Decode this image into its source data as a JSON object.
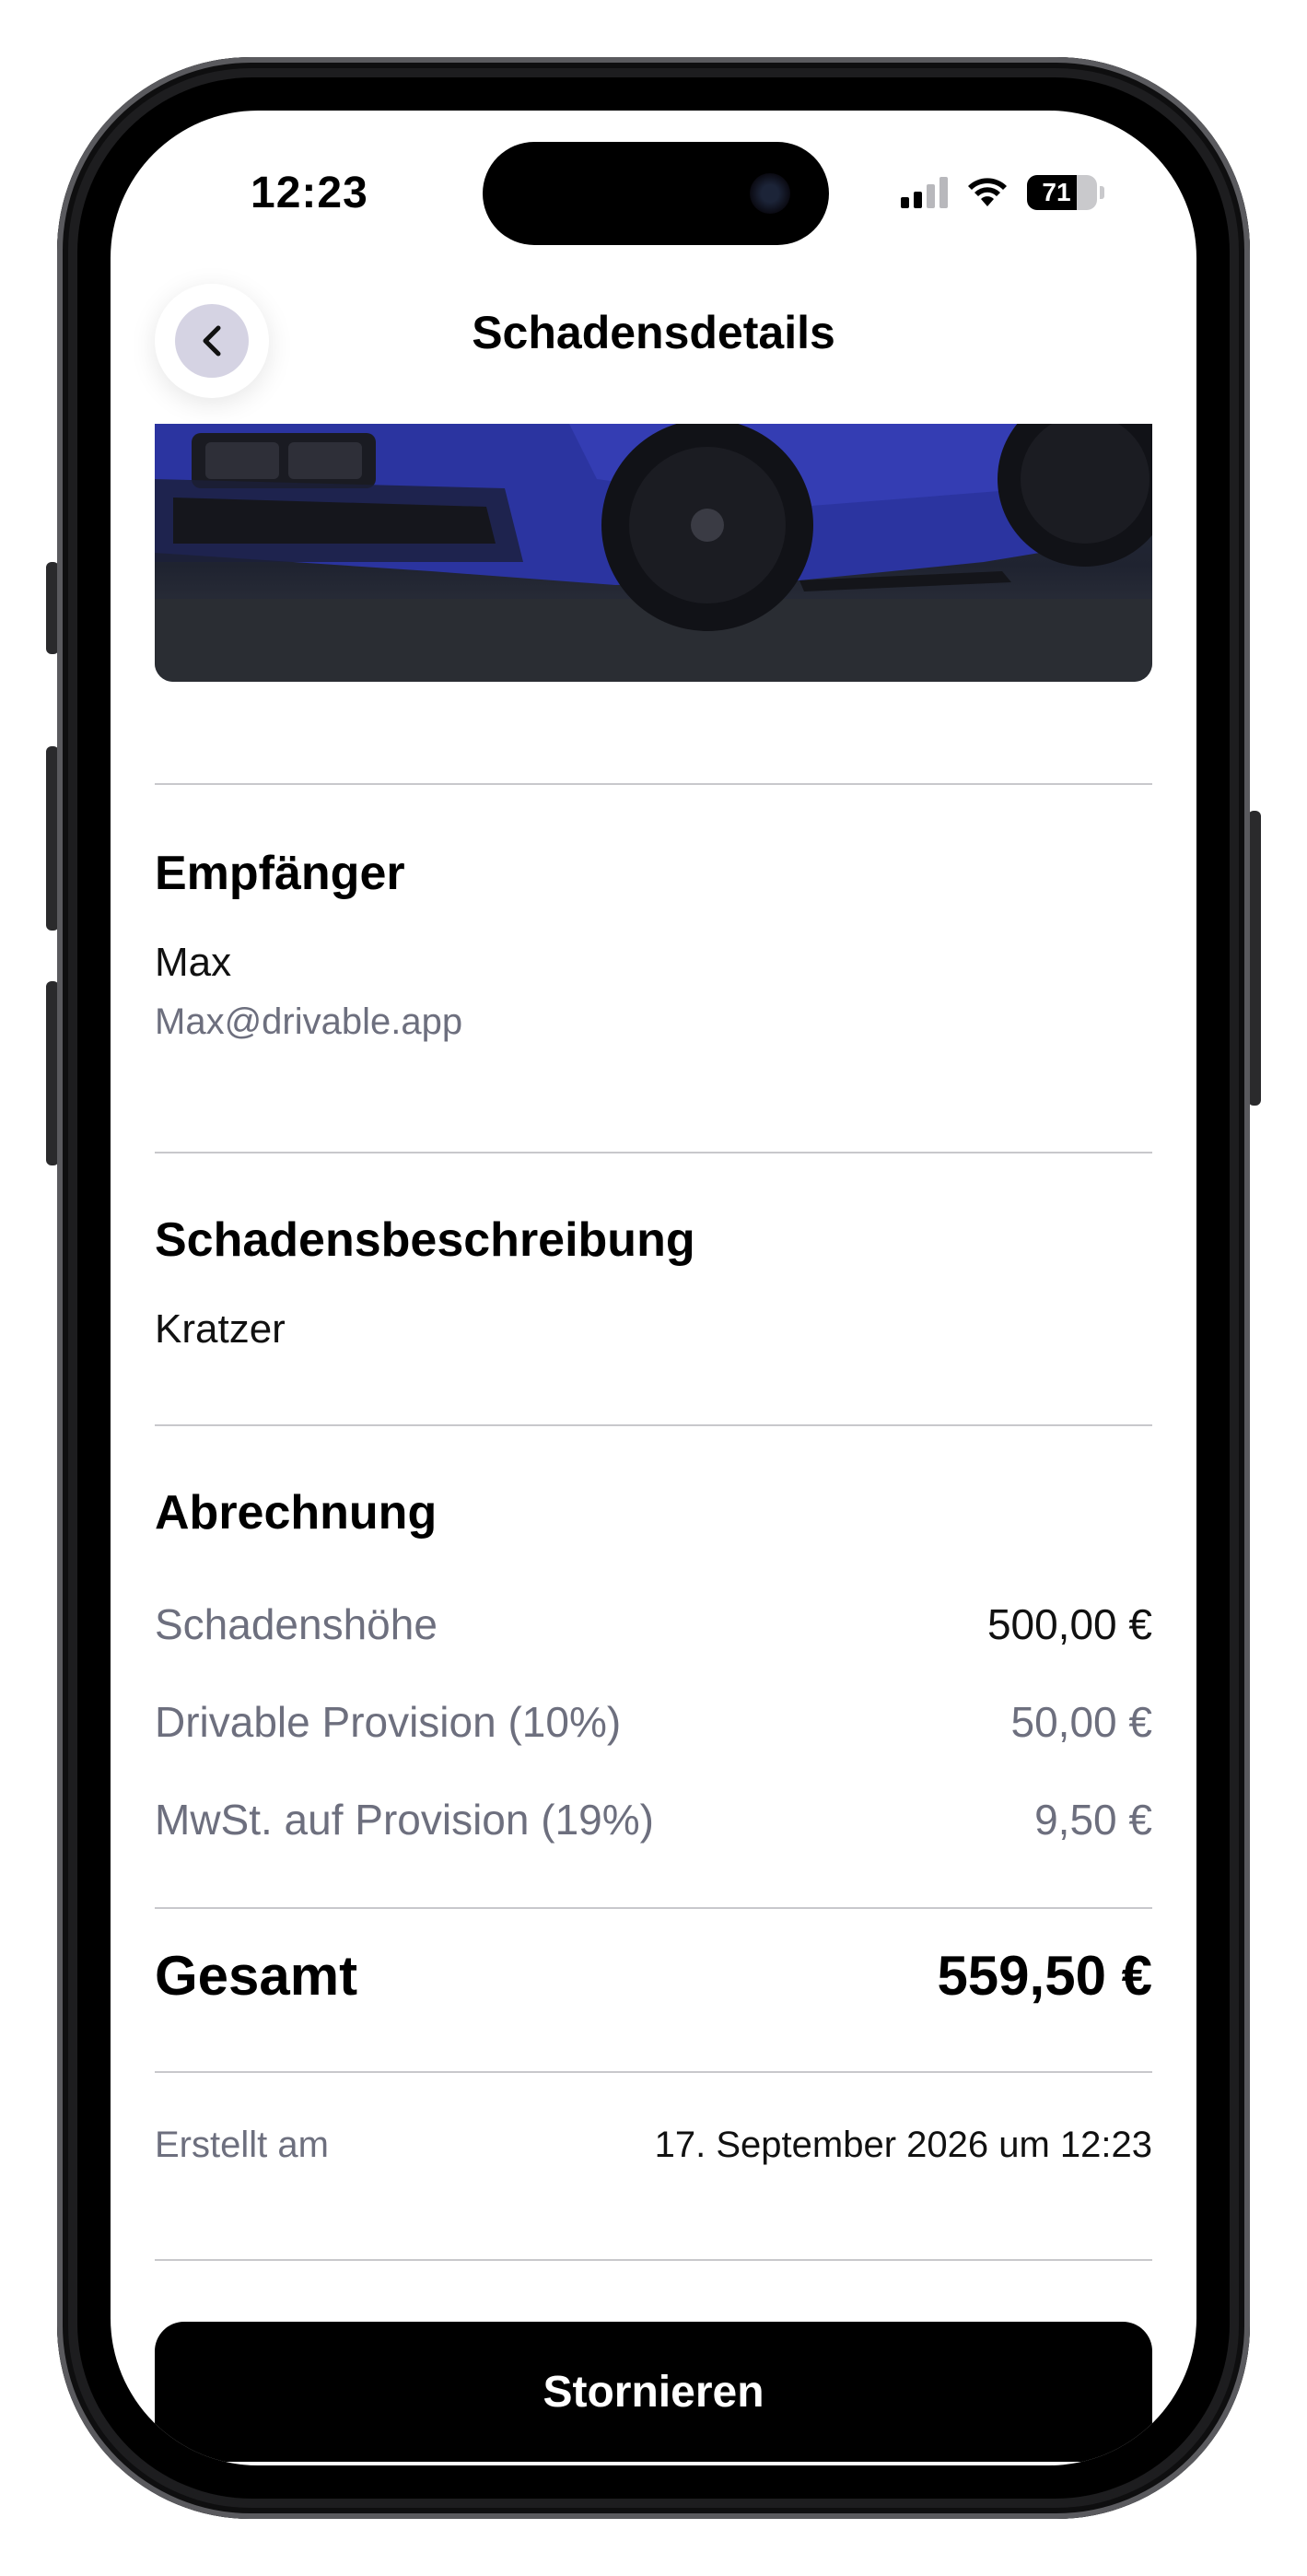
{
  "status_bar": {
    "time": "12:23",
    "battery_level": "71",
    "battery_fraction": 0.71,
    "signal_bars_active": 2,
    "signal_bars_total": 4
  },
  "header": {
    "title": "Schadensdetails",
    "back_icon": "chevron-left-icon"
  },
  "recipient": {
    "heading": "Empfänger",
    "name": "Max",
    "email": "Max@drivable.app"
  },
  "description": {
    "heading": "Schadensbeschreibung",
    "text": "Kratzer"
  },
  "billing": {
    "heading": "Abrechnung",
    "rows": [
      {
        "label": "Schadenshöhe",
        "value": "500,00 €"
      },
      {
        "label": "Drivable Provision (10%)",
        "value": "50,00 €"
      },
      {
        "label": "MwSt. auf Provision (19%)",
        "value": "9,50 €"
      }
    ],
    "total_label": "Gesamt",
    "total_value": "559,50 €"
  },
  "meta": {
    "created_label": "Erstellt am",
    "created_value": "17. September 2026 um 12:23"
  },
  "actions": {
    "cancel_label": "Stornieren"
  },
  "colors": {
    "primary_button": "#000000",
    "muted_text": "#6d6f7e",
    "back_button_bg": "#d5d3e3",
    "car_paint": "#2b34a0"
  }
}
